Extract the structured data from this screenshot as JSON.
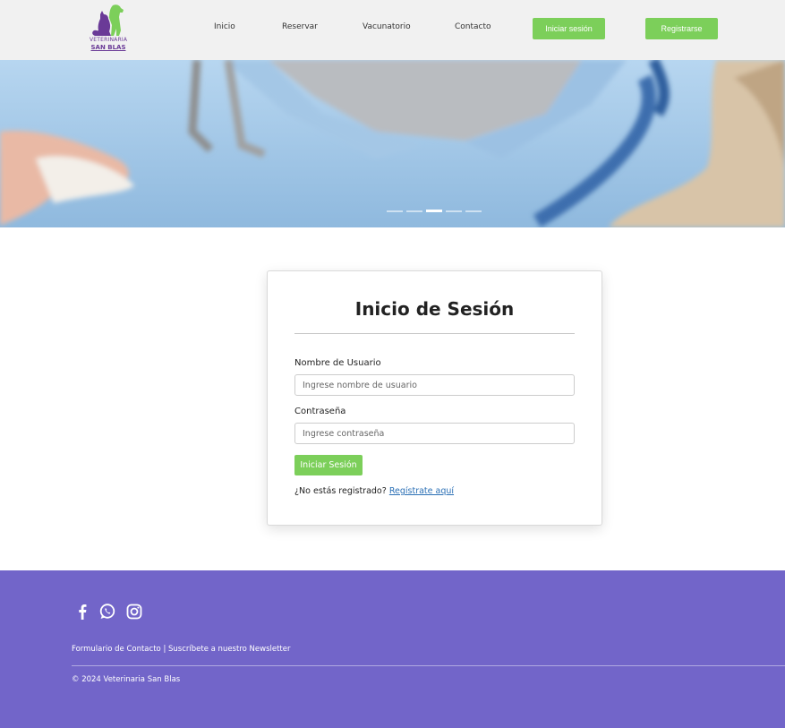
{
  "brand": {
    "line1": "VETERINARIA",
    "line2": "SAN BLAS",
    "color_purple": "#6a3a97",
    "color_green": "#7ccf5a"
  },
  "nav": {
    "links": [
      "Inicio",
      "Reservar",
      "Vacunatorio",
      "Contacto"
    ],
    "login_label": "Iniciar sesión",
    "register_label": "Registrarse"
  },
  "hero": {
    "slide_count": 5,
    "active_slide": 3
  },
  "login": {
    "title": "Inicio de Sesión",
    "username_label": "Nombre de Usuario",
    "username_placeholder": "Ingrese nombre de usuario",
    "password_label": "Contraseña",
    "password_placeholder": "Ingrese contraseña",
    "submit_label": "Iniciar Sesión",
    "register_prompt": "¿No estás registrado?",
    "register_link": "Regístrate aquí"
  },
  "footer": {
    "social_icons": [
      "facebook-icon",
      "whatsapp-icon",
      "instagram-icon"
    ],
    "contact_form": "Formulario de Contacto",
    "separator": "|",
    "newsletter": "Suscríbete a nuestro Newsletter",
    "copyright": "© 2024 Veterinaria San Blas",
    "background": "#7265c9"
  }
}
